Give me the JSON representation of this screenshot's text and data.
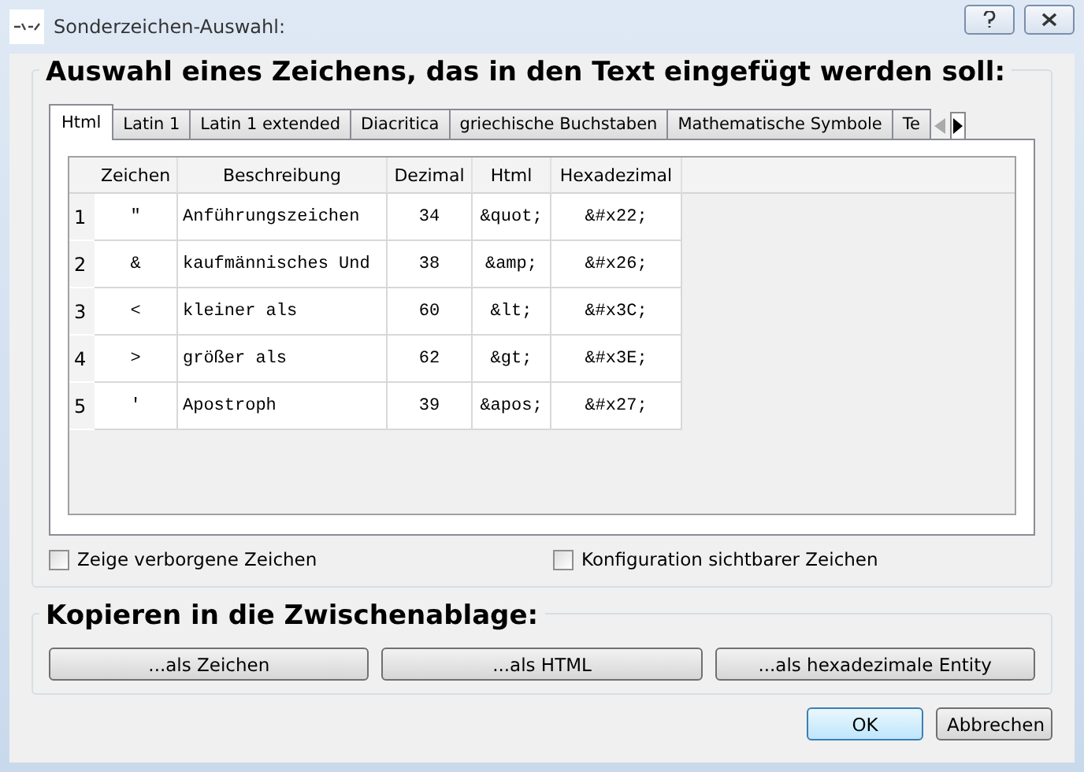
{
  "window": {
    "title": "Sonderzeichen-Auswahl:"
  },
  "selection_group": {
    "title": "Auswahl eines Zeichens, das in den Text eingefügt werden soll:"
  },
  "tabs": [
    {
      "label": "Html",
      "selected": true
    },
    {
      "label": "Latin 1",
      "selected": false
    },
    {
      "label": "Latin 1 extended",
      "selected": false
    },
    {
      "label": "Diacritica",
      "selected": false
    },
    {
      "label": "griechische Buchstaben",
      "selected": false
    },
    {
      "label": "Mathematische Symbole",
      "selected": false
    },
    {
      "label": "Te",
      "selected": false
    }
  ],
  "table": {
    "columns": [
      "Zeichen",
      "Beschreibung",
      "Dezimal",
      "Html",
      "Hexadezimal"
    ],
    "rows": [
      {
        "number": "1",
        "cells": [
          "\"",
          "Anführungszeichen",
          "34",
          "&quot;",
          "&#x22;"
        ]
      },
      {
        "number": "2",
        "cells": [
          "&",
          "kaufmännisches Und",
          "38",
          "&amp;",
          "&#x26;"
        ]
      },
      {
        "number": "3",
        "cells": [
          "<",
          "kleiner als",
          "60",
          "&lt;",
          "&#x3C;"
        ]
      },
      {
        "number": "4",
        "cells": [
          ">",
          "größer als",
          "62",
          "&gt;",
          "&#x3E;"
        ]
      },
      {
        "number": "5",
        "cells": [
          "'",
          "Apostroph",
          "39",
          "&apos;",
          "&#x27;"
        ]
      }
    ]
  },
  "options": [
    {
      "label": "Zeige verborgene Zeichen",
      "checked": false
    },
    {
      "label": "Konfiguration sichtbarer Zeichen",
      "checked": false
    }
  ],
  "copy_group": {
    "title": "Kopieren in die Zwischenablage:",
    "buttons": [
      "...als Zeichen",
      "...als HTML",
      "...als hexadezimale Entity"
    ]
  },
  "buttons": [
    {
      "label": "OK",
      "kind": "default"
    },
    {
      "label": "Abbrechen",
      "kind": "normal"
    }
  ]
}
